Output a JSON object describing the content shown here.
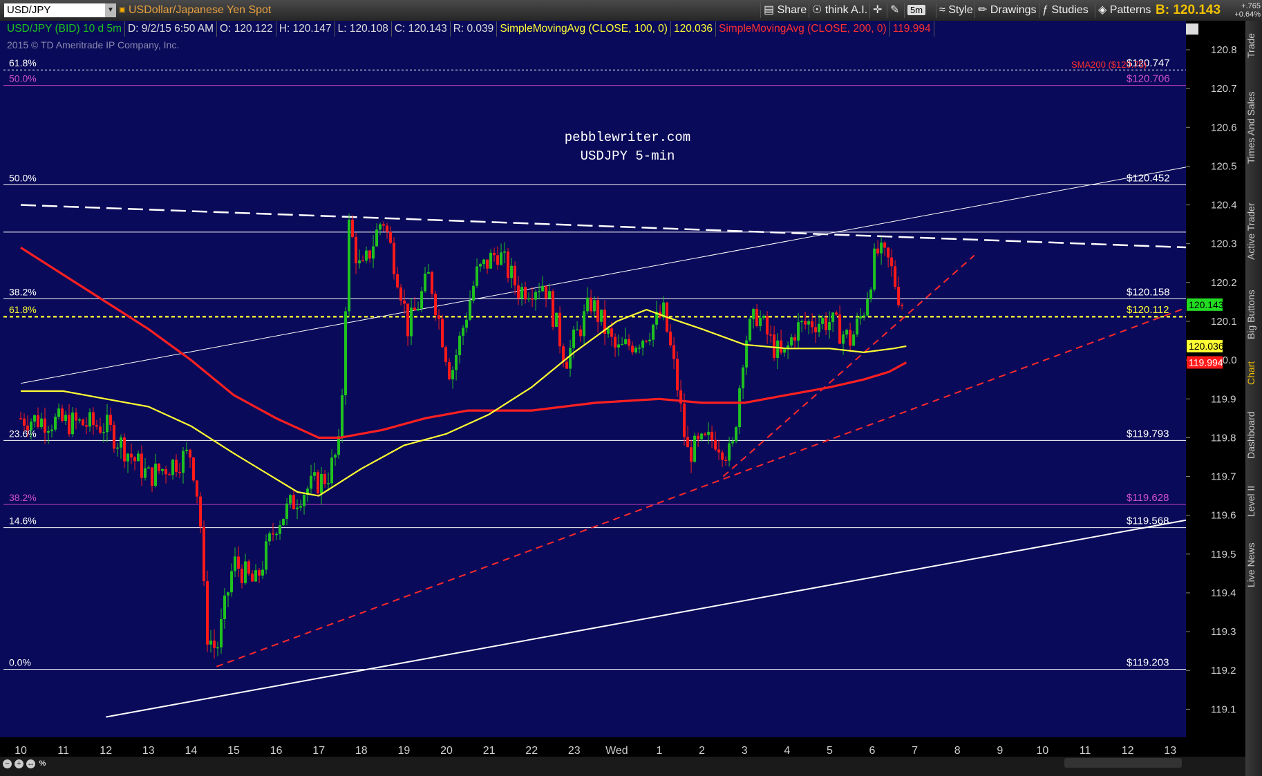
{
  "toolbar": {
    "symbol": "USD/JPY",
    "description": "USDollar/Japanese Yen Spot",
    "buttons": [
      "Share",
      "think A.I.",
      "5m",
      "Style",
      "Drawings",
      "Studies",
      "Patterns"
    ],
    "bid_label": "B:",
    "bid_value": "120.143",
    "change": "+.765",
    "change_pct": "+0.64%"
  },
  "infobar": {
    "instrument": "USD/JPY (BID) 10 d 5m",
    "date": "D: 9/2/15 6:50 AM",
    "open": "O: 120.122",
    "high": "H: 120.147",
    "low": "L: 120.108",
    "close": "C: 120.143",
    "range": "R: 0.039",
    "sma100_label": "SimpleMovingAvg (CLOSE, 100, 0)",
    "sma100_value": "120.036",
    "sma200_label": "SimpleMovingAvg (CLOSE, 200, 0)",
    "sma200_value": "119.994"
  },
  "copyright": "2015 © TD Ameritrade IP Company, Inc.",
  "watermark": [
    "pebblewriter.com",
    "USDJPY 5-min"
  ],
  "sidebar_tabs": [
    "Trade",
    "Times And Sales",
    "Active Trader",
    "Big Buttons",
    "Chart",
    "Dashboard",
    "Level II",
    "Live News"
  ],
  "colors": {
    "background": "#0a0a5a",
    "up_candle": "#1fc21f",
    "down_candle": "#ff1a1a",
    "sma100": "#ffff33",
    "sma200": "#ff2020",
    "fib_white": "#ffffff",
    "fib_magenta": "#c040c0",
    "dotted_level": "#ffff33",
    "trend_dashed_red": "#ff2a2a"
  },
  "chart_data": {
    "type": "candlestick",
    "title": "USDJPY 5-min",
    "ylim": [
      119.1,
      120.85
    ],
    "yticks": [
      119.1,
      119.2,
      119.3,
      119.4,
      119.5,
      119.6,
      119.7,
      119.8,
      119.9,
      120.0,
      120.1,
      120.2,
      120.3,
      120.4,
      120.5,
      120.6,
      120.7,
      120.8
    ],
    "xticks": [
      "10",
      "11",
      "12",
      "13",
      "14",
      "15",
      "16",
      "17",
      "18",
      "19",
      "20",
      "21",
      "22",
      "23",
      "Wed",
      "1",
      "2",
      "3",
      "4",
      "5",
      "6",
      "7",
      "8",
      "9",
      "10",
      "11",
      "12",
      "13"
    ],
    "price_anchors": [
      {
        "x": 0,
        "y": 119.85
      },
      {
        "x": 2,
        "y": 119.83
      },
      {
        "x": 3,
        "y": 119.7
      },
      {
        "x": 4,
        "y": 119.76
      },
      {
        "x": 4.2,
        "y": 119.62
      },
      {
        "x": 4.35,
        "y": 119.3
      },
      {
        "x": 4.6,
        "y": 119.25
      },
      {
        "x": 5.0,
        "y": 119.48
      },
      {
        "x": 5.5,
        "y": 119.42
      },
      {
        "x": 6.0,
        "y": 119.58
      },
      {
        "x": 6.6,
        "y": 119.66
      },
      {
        "x": 7.2,
        "y": 119.7
      },
      {
        "x": 7.5,
        "y": 119.78
      },
      {
        "x": 7.7,
        "y": 120.35
      },
      {
        "x": 8.0,
        "y": 120.22
      },
      {
        "x": 8.5,
        "y": 120.37
      },
      {
        "x": 8.9,
        "y": 120.2
      },
      {
        "x": 9.1,
        "y": 120.08
      },
      {
        "x": 9.6,
        "y": 120.22
      },
      {
        "x": 10.1,
        "y": 119.96
      },
      {
        "x": 10.7,
        "y": 120.22
      },
      {
        "x": 11.2,
        "y": 120.28
      },
      {
        "x": 11.7,
        "y": 120.18
      },
      {
        "x": 12.3,
        "y": 120.2
      },
      {
        "x": 12.8,
        "y": 120.0
      },
      {
        "x": 13.4,
        "y": 120.15
      },
      {
        "x": 14.0,
        "y": 120.02
      },
      {
        "x": 14.6,
        "y": 120.06
      },
      {
        "x": 15.1,
        "y": 120.12
      },
      {
        "x": 15.4,
        "y": 119.95
      },
      {
        "x": 15.65,
        "y": 119.76
      },
      {
        "x": 16.3,
        "y": 119.8
      },
      {
        "x": 16.7,
        "y": 119.75
      },
      {
        "x": 17.0,
        "y": 120.05
      },
      {
        "x": 17.3,
        "y": 120.12
      },
      {
        "x": 17.6,
        "y": 120.05
      },
      {
        "x": 17.9,
        "y": 120.0
      },
      {
        "x": 18.2,
        "y": 120.08
      },
      {
        "x": 18.6,
        "y": 120.1
      },
      {
        "x": 19.0,
        "y": 120.1
      },
      {
        "x": 19.5,
        "y": 120.05
      },
      {
        "x": 19.8,
        "y": 120.13
      },
      {
        "x": 20.1,
        "y": 120.28
      },
      {
        "x": 20.4,
        "y": 120.25
      },
      {
        "x": 20.7,
        "y": 120.14
      }
    ],
    "sma100": [
      {
        "x": 0,
        "y": 119.92
      },
      {
        "x": 1,
        "y": 119.92
      },
      {
        "x": 2,
        "y": 119.9
      },
      {
        "x": 3,
        "y": 119.88
      },
      {
        "x": 4,
        "y": 119.83
      },
      {
        "x": 5,
        "y": 119.76
      },
      {
        "x": 6.5,
        "y": 119.66
      },
      {
        "x": 7.0,
        "y": 119.65
      },
      {
        "x": 8.0,
        "y": 119.72
      },
      {
        "x": 9.0,
        "y": 119.78
      },
      {
        "x": 10.0,
        "y": 119.81
      },
      {
        "x": 11.0,
        "y": 119.86
      },
      {
        "x": 12.0,
        "y": 119.93
      },
      {
        "x": 13.0,
        "y": 120.02
      },
      {
        "x": 14.0,
        "y": 120.1
      },
      {
        "x": 14.7,
        "y": 120.13
      },
      {
        "x": 15.2,
        "y": 120.11
      },
      {
        "x": 16.0,
        "y": 120.08
      },
      {
        "x": 17.0,
        "y": 120.04
      },
      {
        "x": 18.0,
        "y": 120.03
      },
      {
        "x": 19.0,
        "y": 120.03
      },
      {
        "x": 19.8,
        "y": 120.02
      },
      {
        "x": 20.5,
        "y": 120.03
      },
      {
        "x": 20.8,
        "y": 120.036
      }
    ],
    "sma200": [
      {
        "x": 0,
        "y": 120.29
      },
      {
        "x": 1,
        "y": 120.22
      },
      {
        "x": 2,
        "y": 120.15
      },
      {
        "x": 3,
        "y": 120.08
      },
      {
        "x": 4,
        "y": 120.0
      },
      {
        "x": 5,
        "y": 119.91
      },
      {
        "x": 6,
        "y": 119.85
      },
      {
        "x": 7,
        "y": 119.8
      },
      {
        "x": 7.5,
        "y": 119.8
      },
      {
        "x": 8.5,
        "y": 119.82
      },
      {
        "x": 9.5,
        "y": 119.85
      },
      {
        "x": 10.5,
        "y": 119.87
      },
      {
        "x": 12.0,
        "y": 119.87
      },
      {
        "x": 13.5,
        "y": 119.89
      },
      {
        "x": 15.0,
        "y": 119.9
      },
      {
        "x": 16.0,
        "y": 119.89
      },
      {
        "x": 17.0,
        "y": 119.89
      },
      {
        "x": 18.0,
        "y": 119.91
      },
      {
        "x": 19.0,
        "y": 119.93
      },
      {
        "x": 19.8,
        "y": 119.95
      },
      {
        "x": 20.4,
        "y": 119.97
      },
      {
        "x": 20.8,
        "y": 119.994
      }
    ],
    "horizontal_levels": [
      {
        "y": 120.748,
        "left_label": "61.8%",
        "right_label": "$120.747",
        "color": "white",
        "dash": true
      },
      {
        "y": 120.708,
        "left_label": "50.0%",
        "right_label": "$120.706",
        "color": "magenta"
      },
      {
        "y": 120.452,
        "left_label": "50.0%",
        "right_label": "$120.452",
        "color": "white"
      },
      {
        "y": 120.33,
        "left_label": "",
        "right_label": "",
        "color": "white"
      },
      {
        "y": 120.158,
        "left_label": "38.2%",
        "right_label": "$120.158",
        "color": "white"
      },
      {
        "y": 120.112,
        "left_label": "61.8%",
        "right_label": "$120.112",
        "color": "yellow",
        "dash": true
      },
      {
        "y": 119.793,
        "left_label": "23.6%",
        "right_label": "$119.793",
        "color": "white"
      },
      {
        "y": 119.628,
        "left_label": "38.2%",
        "right_label": "$119.628",
        "color": "magenta"
      },
      {
        "y": 119.568,
        "left_label": "14.6%",
        "right_label": "$119.568",
        "color": "white"
      },
      {
        "y": 119.203,
        "left_label": "0.0%",
        "right_label": "$119.203",
        "color": "white"
      }
    ],
    "sma200_annotation": "SMA200 ($120.75)",
    "trendlines": [
      {
        "x1": 0,
        "y1": 120.4,
        "x2": 27.5,
        "y2": 120.29,
        "style": "white-dashed"
      },
      {
        "x1": 0,
        "y1": 119.94,
        "x2": 27.5,
        "y2": 120.5,
        "style": "white-thin"
      },
      {
        "x1": 2,
        "y1": 119.08,
        "x2": 27.5,
        "y2": 119.59,
        "style": "white-solid"
      },
      {
        "x1": 4.6,
        "y1": 119.21,
        "x2": 27.5,
        "y2": 120.14,
        "style": "red-dashed"
      },
      {
        "x1": 16.5,
        "y1": 119.7,
        "x2": 22.4,
        "y2": 120.27,
        "style": "red-dashed"
      }
    ],
    "price_labels": [
      {
        "y": 120.143,
        "text": "120.143",
        "bg": "#22dd22",
        "fg": "#000"
      },
      {
        "y": 120.036,
        "text": "120.036",
        "bg": "#ffff33",
        "fg": "#000"
      },
      {
        "y": 119.994,
        "text": "119.994",
        "bg": "#ff1a1a",
        "fg": "#fff"
      }
    ]
  }
}
